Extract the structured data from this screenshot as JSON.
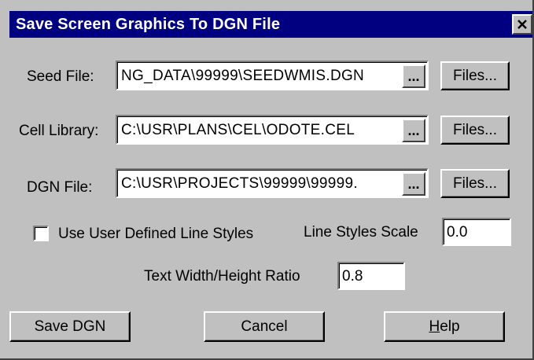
{
  "window": {
    "title": "Save Screen Graphics To DGN File"
  },
  "seed_file": {
    "label": "Seed File:",
    "value": "NG_DATA\\99999\\SEEDWMIS.DGN",
    "browse_label": "...",
    "files_label": "Files..."
  },
  "cell_library": {
    "label": "Cell Library:",
    "value": "C:\\USR\\PLANS\\CEL\\ODOTE.CEL",
    "browse_label": "...",
    "files_label": "Files..."
  },
  "dgn_file": {
    "label": "DGN File:",
    "value": "C:\\USR\\PROJECTS\\99999\\99999.",
    "browse_label": "...",
    "files_label": "Files..."
  },
  "options": {
    "user_line_styles_label": "Use User Defined Line Styles",
    "user_line_styles_checked": false,
    "line_styles_scale_label": "Line Styles Scale",
    "line_styles_scale_value": "0.0",
    "text_ratio_label": "Text Width/Height Ratio",
    "text_ratio_value": "0.8"
  },
  "buttons": {
    "save": "Save DGN",
    "cancel": "Cancel",
    "help_first": "H",
    "help_rest": "elp"
  },
  "colors": {
    "titlebar": "#000080",
    "face": "#c0c0c0"
  }
}
